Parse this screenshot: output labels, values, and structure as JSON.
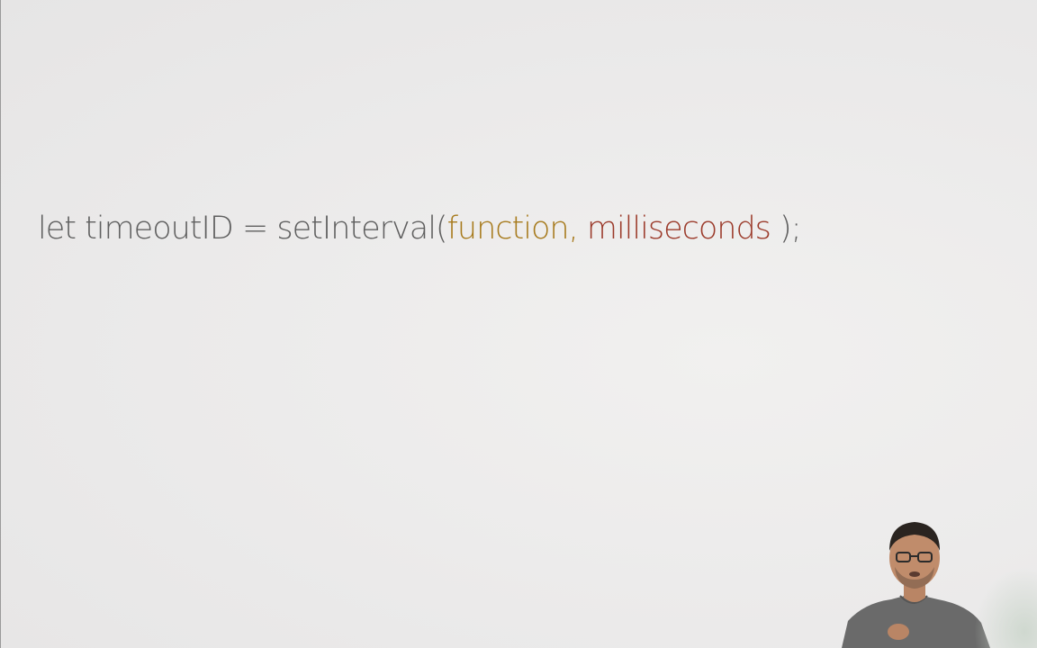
{
  "code": {
    "kw_let": "let",
    "var_name": "timeoutID",
    "equals": "=",
    "func_name": "setInterval(",
    "arg_function": "function,",
    "arg_ms": "milliseconds",
    "close": ");"
  },
  "colors": {
    "background": "#ecebeb",
    "text": "#5f5f5f",
    "function_arg": "#a77a1c",
    "milliseconds_arg": "#9b3a2a"
  },
  "presenter": {
    "description_icon": "presenter-video-icon"
  }
}
